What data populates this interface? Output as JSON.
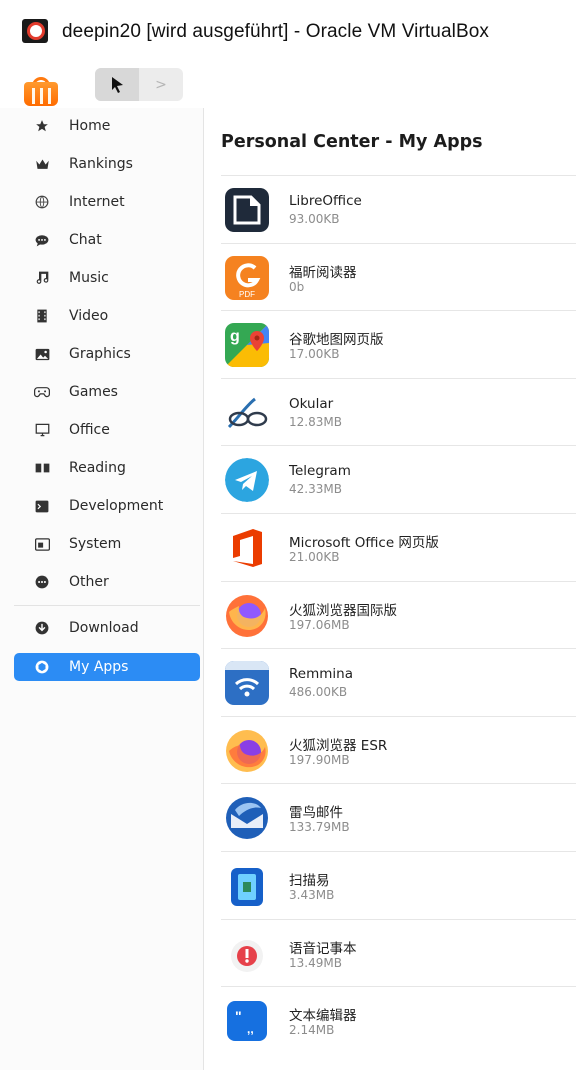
{
  "window": {
    "title": "deepin20 [wird ausgeführt] - Oracle VM VirtualBox"
  },
  "toolbar": {
    "back_icon": "cursor-back-icon",
    "forward_label": ">"
  },
  "sidebar": {
    "items": [
      {
        "key": "home",
        "label": "Home",
        "icon": "star-icon"
      },
      {
        "key": "rankings",
        "label": "Rankings",
        "icon": "crown-icon"
      },
      {
        "key": "internet",
        "label": "Internet",
        "icon": "globe-icon"
      },
      {
        "key": "chat",
        "label": "Chat",
        "icon": "chat-bubble-icon"
      },
      {
        "key": "music",
        "label": "Music",
        "icon": "music-note-icon"
      },
      {
        "key": "video",
        "label": "Video",
        "icon": "film-icon"
      },
      {
        "key": "graphics",
        "label": "Graphics",
        "icon": "image-icon"
      },
      {
        "key": "games",
        "label": "Games",
        "icon": "gamepad-icon"
      },
      {
        "key": "office",
        "label": "Office",
        "icon": "monitor-icon"
      },
      {
        "key": "reading",
        "label": "Reading",
        "icon": "book-icon"
      },
      {
        "key": "development",
        "label": "Development",
        "icon": "terminal-icon"
      },
      {
        "key": "system",
        "label": "System",
        "icon": "settings-window-icon"
      },
      {
        "key": "other",
        "label": "Other",
        "icon": "more-dots-icon"
      }
    ],
    "download": {
      "label": "Download",
      "icon": "download-icon"
    },
    "my_apps": {
      "label": "My Apps",
      "icon": "cube-icon",
      "active": true
    }
  },
  "main": {
    "title": "Personal Center - My Apps",
    "apps": [
      {
        "name": "LibreOffice",
        "size": "93.00KB",
        "icon": "libreoffice-icon"
      },
      {
        "name": "福昕阅读器",
        "size": "0b",
        "icon": "foxit-reader-icon"
      },
      {
        "name": "谷歌地图网页版",
        "size": "17.00KB",
        "icon": "google-maps-icon"
      },
      {
        "name": "Okular",
        "size": "12.83MB",
        "icon": "okular-icon"
      },
      {
        "name": "Telegram",
        "size": "42.33MB",
        "icon": "telegram-icon"
      },
      {
        "name": "Microsoft Office 网页版",
        "size": "21.00KB",
        "icon": "microsoft-office-icon"
      },
      {
        "name": "火狐浏览器国际版",
        "size": "197.06MB",
        "icon": "firefox-icon"
      },
      {
        "name": "Remmina",
        "size": "486.00KB",
        "icon": "remmina-icon"
      },
      {
        "name": "火狐浏览器 ESR",
        "size": "197.90MB",
        "icon": "firefox-esr-icon"
      },
      {
        "name": "雷鸟邮件",
        "size": "133.79MB",
        "icon": "thunderbird-icon"
      },
      {
        "name": "扫描易",
        "size": "3.43MB",
        "icon": "scanner-icon"
      },
      {
        "name": "语音记事本",
        "size": "13.49MB",
        "icon": "voice-note-icon"
      },
      {
        "name": "文本编辑器",
        "size": "2.14MB",
        "icon": "text-editor-icon"
      }
    ]
  },
  "colors": {
    "accent": "#2c8cf4",
    "store_orange": "#ff7a10",
    "vbox_red": "#e23b2c"
  }
}
